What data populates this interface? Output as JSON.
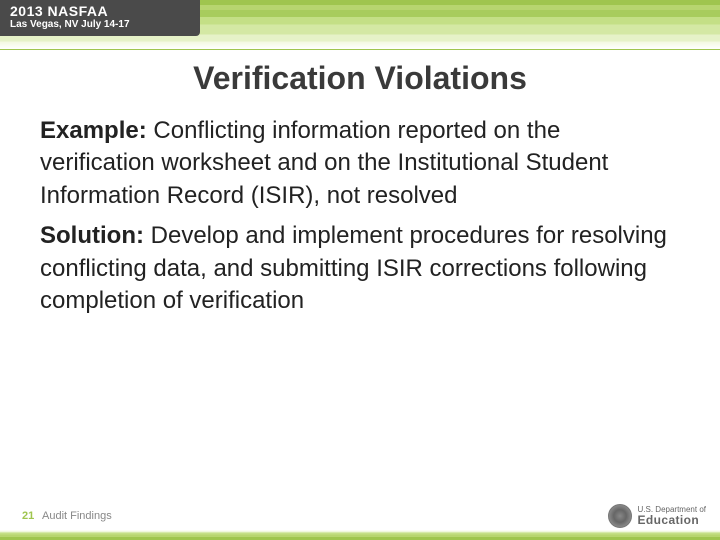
{
  "header": {
    "event_line1": "2013 NASFAA",
    "event_line2": "Las Vegas, NV July 14-17"
  },
  "slide": {
    "title": "Verification Violations",
    "example_label": "Example:",
    "example_text": " Conflicting information reported on the verification worksheet and on the Institutional Student Information Record (ISIR), not resolved",
    "solution_label": "Solution:",
    "solution_text": " Develop and implement procedures for resolving conflicting data, and submitting ISIR corrections following completion of verification"
  },
  "footer": {
    "page_number": "21",
    "section": "Audit Findings",
    "dept_prefix": "U.S. Department of",
    "dept_name": "Education"
  }
}
